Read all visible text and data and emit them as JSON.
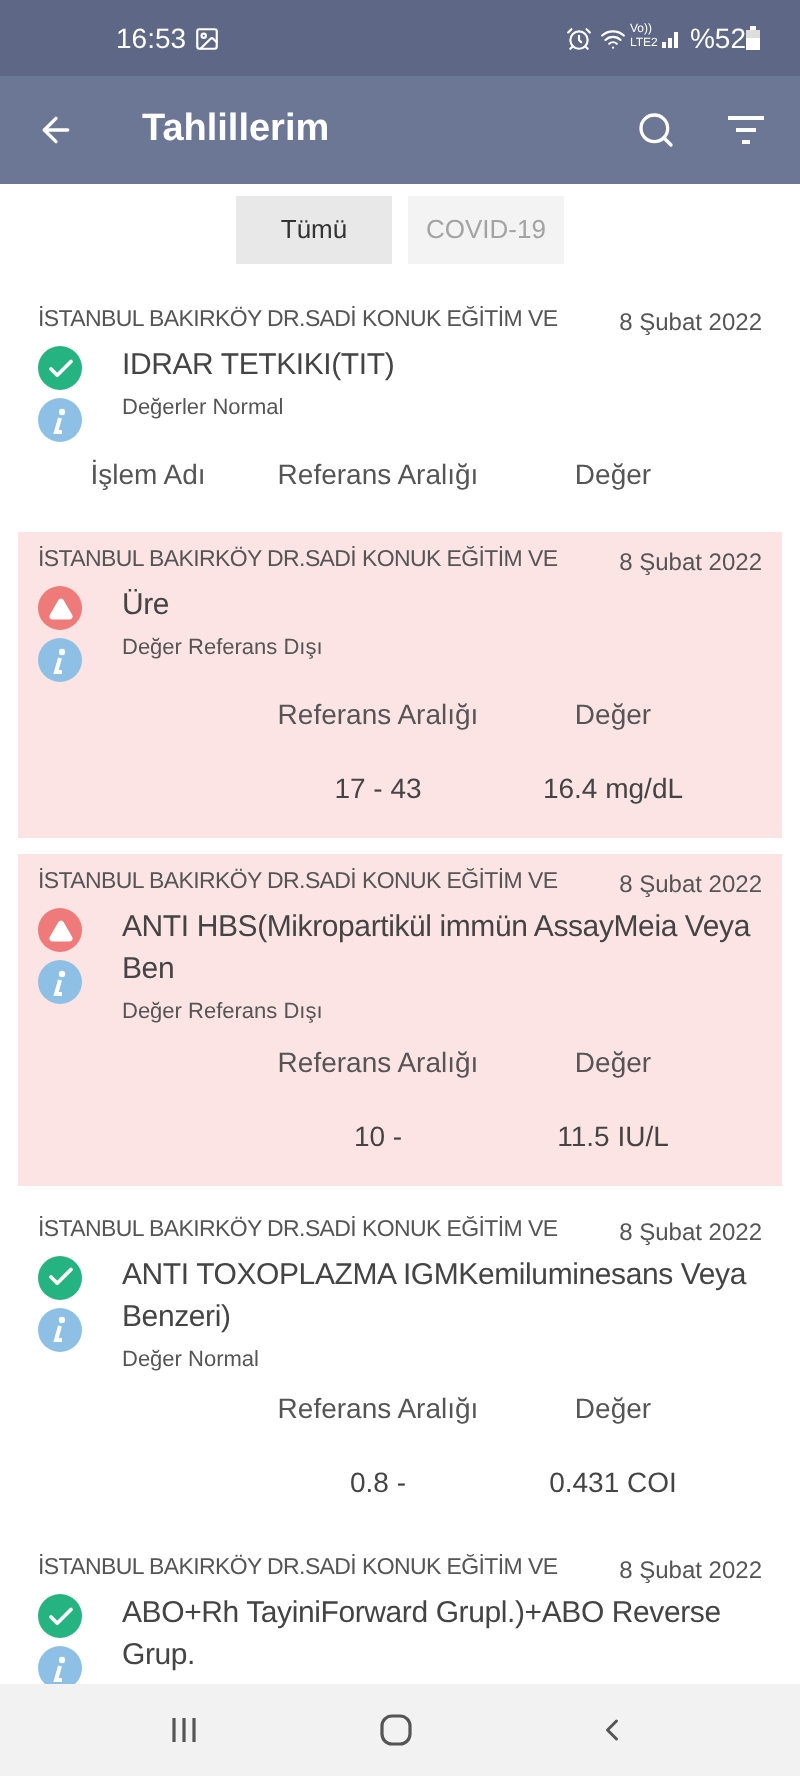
{
  "status_bar": {
    "time": "16:53",
    "network": "Vo)) LTE2",
    "battery": "%52"
  },
  "app_bar": {
    "title": "Tahlillerim"
  },
  "filters": [
    {
      "label": "Tümü",
      "selected": true
    },
    {
      "label": "COVID-19",
      "selected": false
    }
  ],
  "results": [
    {
      "kind": "normal",
      "hospital": "İSTANBUL BAKIRKÖY DR.SADİ KONUK EĞİTİM VE",
      "date": "8 Şubat 2022",
      "test": "IDRAR TETKIKI(TIT)",
      "status": "Değerler Normal",
      "columns": [
        "İşlem Adı",
        "Referans Aralığı",
        "Değer"
      ]
    },
    {
      "kind": "abnormal",
      "hospital": "İSTANBUL BAKIRKÖY DR.SADİ KONUK EĞİTİM VE",
      "date": "8 Şubat 2022",
      "test": "Üre",
      "status": "Değer Referans Dışı",
      "columns": [
        "Referans Aralığı",
        "Değer"
      ],
      "range": "17 - 43",
      "value": "16.4 mg/dL"
    },
    {
      "kind": "abnormal",
      "hospital": "İSTANBUL BAKIRKÖY DR.SADİ KONUK EĞİTİM VE",
      "date": "8 Şubat 2022",
      "test": "ANTI HBS(Mikropartikül immün AssayMeia Veya Ben",
      "status": "Değer Referans Dışı",
      "columns": [
        "Referans Aralığı",
        "Değer"
      ],
      "range": "10 -",
      "value": "11.5 IU/L"
    },
    {
      "kind": "normal",
      "hospital": "İSTANBUL BAKIRKÖY DR.SADİ KONUK EĞİTİM VE",
      "date": "8 Şubat 2022",
      "test": "ANTI TOXOPLAZMA IGMKemiluminesans Veya Benzeri)",
      "status": "Değer Normal",
      "columns": [
        "Referans Aralığı",
        "Değer"
      ],
      "range": "0.8 -",
      "value": "0.431 COI"
    },
    {
      "kind": "normal",
      "hospital": "İSTANBUL BAKIRKÖY DR.SADİ KONUK EĞİTİM VE",
      "date": "8 Şubat 2022",
      "test": "ABO+Rh TayiniForward Grupl.)+ABO Reverse Grup."
    }
  ]
}
